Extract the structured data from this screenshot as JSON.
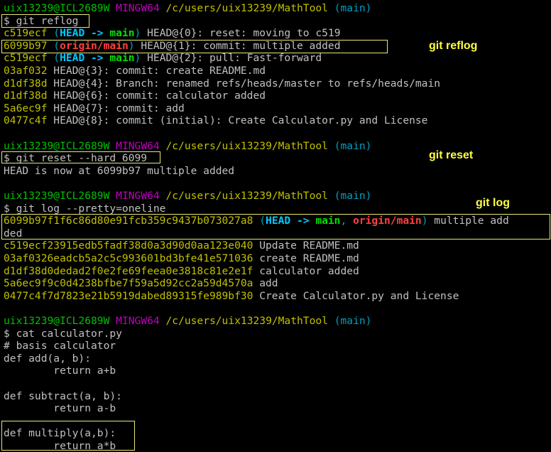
{
  "terminal": {
    "prompt": {
      "user": "uix13239@ICL2689W",
      "env": "MINGW64",
      "path": "/c/users/uix13239/MathTool",
      "branch": "(main)"
    },
    "commands": {
      "reflog": "$ git reflog",
      "reset": "$ git reset --hard 6099",
      "log": "$ git log --pretty=oneline",
      "cat": "$ cat calculator.py"
    },
    "reflog": [
      {
        "hash": "c519ecf",
        "refs": [
          {
            "t": " (",
            "c": "cyan"
          },
          {
            "t": "HEAD -> ",
            "c": "bcyan"
          },
          {
            "t": "main",
            "c": "bgreen"
          },
          {
            "t": ")",
            "c": "cyan"
          }
        ],
        "text": " HEAD@{0}: reset: moving to c519"
      },
      {
        "hash": "6099b97",
        "refs": [
          {
            "t": " (",
            "c": "cyan"
          },
          {
            "t": "origin/main",
            "c": "bred"
          },
          {
            "t": ")",
            "c": "cyan"
          }
        ],
        "text": " HEAD@{1}: commit: multiple added"
      },
      {
        "hash": "c519ecf",
        "refs": [
          {
            "t": " (",
            "c": "cyan"
          },
          {
            "t": "HEAD -> ",
            "c": "bcyan"
          },
          {
            "t": "main",
            "c": "bgreen"
          },
          {
            "t": ")",
            "c": "cyan"
          }
        ],
        "text": " HEAD@{2}: pull: Fast-forward"
      },
      {
        "hash": "03af032",
        "refs": [],
        "text": " HEAD@{3}: commit: create README.md"
      },
      {
        "hash": "d1df38d",
        "refs": [],
        "text": " HEAD@{4}: Branch: renamed refs/heads/master to refs/heads/main"
      },
      {
        "hash": "d1df38d",
        "refs": [],
        "text": " HEAD@{6}: commit: calculator added"
      },
      {
        "hash": "5a6ec9f",
        "refs": [],
        "text": " HEAD@{7}: commit: add"
      },
      {
        "hash": "0477c4f",
        "refs": [],
        "text": " HEAD@{8}: commit (initial): Create Calculator.py and License"
      }
    ],
    "reset_output": "HEAD is now at 6099b97 multiple added",
    "log": [
      {
        "hash": "6099b97f1f6c86d80e91fcb359c9437b073027a8",
        "refs": [
          {
            "t": " (",
            "c": "cyan"
          },
          {
            "t": "HEAD -> ",
            "c": "bcyan"
          },
          {
            "t": "main",
            "c": "bgreen"
          },
          {
            "t": ", ",
            "c": "cyan"
          },
          {
            "t": "origin/main",
            "c": "bred"
          },
          {
            "t": ")",
            "c": "cyan"
          }
        ],
        "text": " multiple add"
      },
      {
        "hash": "",
        "refs": [],
        "text": "ded"
      },
      {
        "hash": "c519ecf23915edb5fadf38d0a3d90d0aa123e040",
        "refs": [],
        "text": " Update README.md"
      },
      {
        "hash": "03af0326eadcb5a2c5c993601bd3bfe41e571036",
        "refs": [],
        "text": " create README.md"
      },
      {
        "hash": "d1df38d0dedad2f0e2fe69feea0e3818c81e2e1f",
        "refs": [],
        "text": " calculator added"
      },
      {
        "hash": "5a6ec9f9c0d4238bfbe7f59a5d92cc2a59d4570a",
        "refs": [],
        "text": " add"
      },
      {
        "hash": "0477c4f7d7823e21b5919dabed89315fe989bf30",
        "refs": [],
        "text": " Create Calculator.py and License"
      }
    ],
    "file": [
      "# basis calculator",
      "def add(a, b):",
      "        return a+b",
      "",
      "def subtract(a, b):",
      "        return a-b",
      "",
      "def multiply(a,b):",
      "        return a*b"
    ]
  },
  "annotations": {
    "reflog": "git reflog",
    "reset": "git reset",
    "log": "git log"
  },
  "colors": {
    "background": "#000000",
    "prompt_user": "#00c000",
    "prompt_env": "#c000c0",
    "prompt_path": "#c0c000",
    "prompt_branch": "#00a0c0",
    "hash": "#c0c000",
    "annotation": "#ffff40",
    "highlight_box": "#e8e878"
  }
}
